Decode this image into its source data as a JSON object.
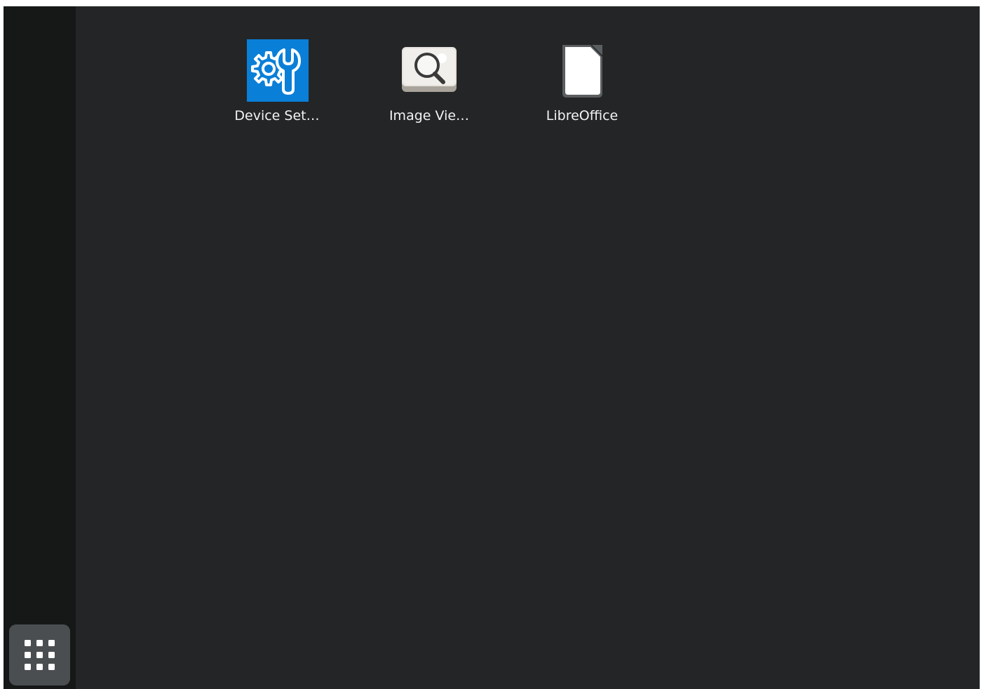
{
  "desktop": {
    "apps": [
      {
        "label": "Device Set…",
        "icon": "device-settings-icon"
      },
      {
        "label": "Image Vie…",
        "icon": "image-viewer-icon"
      },
      {
        "label": "LibreOffice",
        "icon": "libreoffice-icon"
      }
    ]
  },
  "dock": {
    "app_grid_icon": "app-grid-icon"
  },
  "colors": {
    "background": "#232526",
    "dock": "#161818",
    "app_grid_button": "#4b4e50",
    "device_settings_blue": "#0a7fd8",
    "label_text": "#f3f3f3"
  }
}
